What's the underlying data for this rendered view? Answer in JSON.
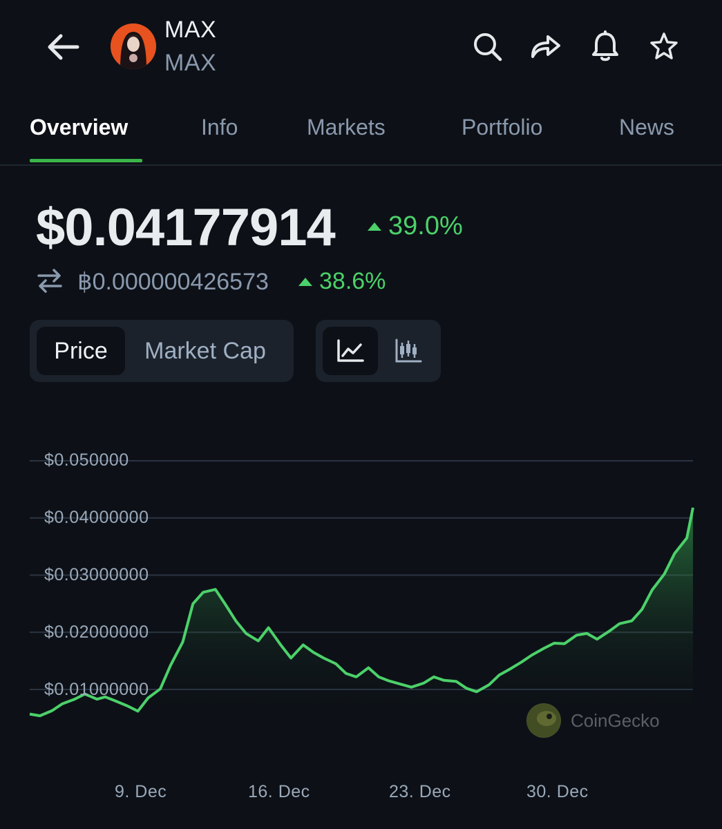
{
  "header": {
    "coin_name": "MAX",
    "coin_symbol": "MAX",
    "icons": [
      "back-arrow-icon",
      "search-icon",
      "share-icon",
      "bell-icon",
      "star-icon"
    ]
  },
  "tabs": [
    "Overview",
    "Info",
    "Markets",
    "Portfolio",
    "News"
  ],
  "active_tab": "Overview",
  "price": {
    "usd": "$0.04177914",
    "usd_change": "39.0%",
    "btc": "฿0.000000426573",
    "btc_change": "38.6%"
  },
  "toggle": {
    "price_label": "Price",
    "market_cap_label": "Market Cap",
    "active": "Price",
    "chart_modes": [
      "line-chart-icon",
      "candlestick-icon"
    ],
    "active_mode": "line-chart-icon"
  },
  "watermark": "CoinGecko",
  "colors": {
    "background": "#0d1117",
    "positive": "#4cd16a",
    "accent": "#3bb54a",
    "muted_text": "#8a99ad"
  },
  "chart_data": {
    "type": "area",
    "y_tick_labels": [
      "$0.050000",
      "$0.04000000",
      "$0.03000000",
      "$0.02000000",
      "$0.01000000"
    ],
    "y_ticks": [
      0.05,
      0.04,
      0.03,
      0.02,
      0.01
    ],
    "x_tick_labels": [
      "9. Dec",
      "16. Dec",
      "23. Dec",
      "30. Dec"
    ],
    "x_ticks": [
      8.9,
      15.9,
      23.0,
      29.9
    ],
    "ylim": [
      0.0,
      0.05
    ],
    "xlim": [
      4.7,
      37.2
    ],
    "grid": true,
    "x": [
      4.7,
      5.2,
      5.8,
      6.3,
      6.9,
      7.4,
      8.0,
      8.4,
      8.9,
      9.5,
      10.0,
      10.5,
      11.1,
      11.6,
      12.2,
      12.7,
      13.2,
      13.8,
      14.3,
      14.8,
      15.3,
      15.9,
      16.4,
      17.0,
      17.5,
      18.1,
      18.6,
      19.1,
      19.7,
      20.2,
      20.7,
      21.3,
      21.8,
      22.3,
      22.9,
      23.4,
      24.0,
      24.5,
      25.0,
      25.6,
      26.1,
      26.6,
      27.2,
      27.7,
      28.2,
      28.8,
      29.3,
      29.9,
      30.4,
      30.9,
      31.5,
      32.0,
      32.5,
      33.1,
      33.6,
      34.2,
      34.7,
      35.2,
      35.8,
      36.3,
      36.9,
      37.2
    ],
    "values": [
      0.0057,
      0.0054,
      0.0063,
      0.0075,
      0.0083,
      0.0092,
      0.0083,
      0.0087,
      0.008,
      0.0071,
      0.0062,
      0.0085,
      0.0101,
      0.0142,
      0.0183,
      0.025,
      0.027,
      0.0275,
      0.0248,
      0.022,
      0.0198,
      0.0185,
      0.0208,
      0.0178,
      0.0155,
      0.0178,
      0.0165,
      0.0155,
      0.0145,
      0.0128,
      0.0122,
      0.0138,
      0.0122,
      0.0115,
      0.0109,
      0.0104,
      0.0111,
      0.0122,
      0.0116,
      0.0114,
      0.0102,
      0.0096,
      0.0108,
      0.0125,
      0.0135,
      0.0148,
      0.016,
      0.0172,
      0.0181,
      0.018,
      0.0195,
      0.0198,
      0.0188,
      0.0202,
      0.0215,
      0.022,
      0.024,
      0.0274,
      0.0302,
      0.0338,
      0.0365,
      0.0418
    ]
  }
}
